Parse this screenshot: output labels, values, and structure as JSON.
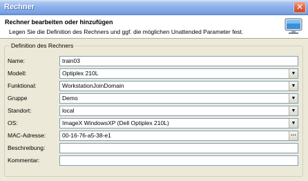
{
  "window": {
    "title": "Rechner",
    "close_glyph": "✕"
  },
  "header": {
    "title": "Rechner bearbeiten oder hinzufügen",
    "description": "Legen Sie die Definition des Rechners und ggf. die möglichen Unattended Parameter fest.",
    "icon": "monitor-icon"
  },
  "group": {
    "legend": "Definition des Rechners",
    "fields": {
      "name": {
        "label": "Name:",
        "value": "train03"
      },
      "modell": {
        "label": "Modell:",
        "value": "Optiplex 210L"
      },
      "funktional": {
        "label": "Funktional:",
        "value": "WorkstationJoinDomain"
      },
      "gruppe": {
        "label": "Gruppe",
        "value": "Demo"
      },
      "standort": {
        "label": "Standort:",
        "value": "local"
      },
      "os": {
        "label": "OS:",
        "value": "ImageX WindowsXP (Dell Optiplex 210L)"
      },
      "mac": {
        "label": "MAC-Adresse:",
        "value": "00-16-76-a5-38-e1"
      },
      "beschreibung": {
        "label": "Beschreibung:",
        "value": ""
      },
      "kommentar": {
        "label": "Kommentar:",
        "value": ""
      }
    },
    "dropdown_glyph": "▼",
    "browse_glyph": "···"
  }
}
